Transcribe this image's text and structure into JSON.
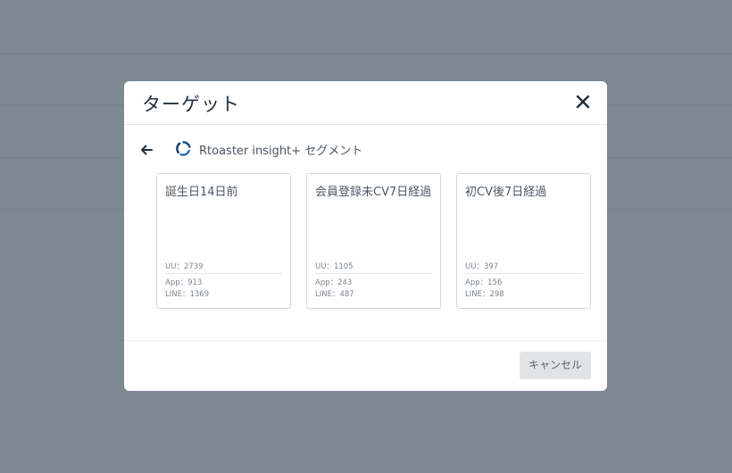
{
  "dialog": {
    "title": "ターゲット",
    "breadcrumb": "Rtoaster insight+ セグメント",
    "cancel_label": "キャンセル"
  },
  "cards": [
    {
      "name": "誕生日14日前",
      "uu": "UU：2739",
      "app": "App：913",
      "line": "LINE：1369"
    },
    {
      "name": "会員登録未CV7日経過",
      "uu": "UU：1105",
      "app": "App：243",
      "line": "LINE：487"
    },
    {
      "name": "初CV後7日経過",
      "uu": "UU：397",
      "app": "App：156",
      "line": "LINE：298"
    }
  ],
  "icons": {
    "close": "close-icon",
    "back": "arrow-left-icon",
    "logo": "rtoaster-logo-icon"
  },
  "colors": {
    "overlay": "#7d8893",
    "title_text": "#22313f",
    "logo_blue": "#1f4e8c",
    "cancel_bg": "#e1e3e6"
  }
}
